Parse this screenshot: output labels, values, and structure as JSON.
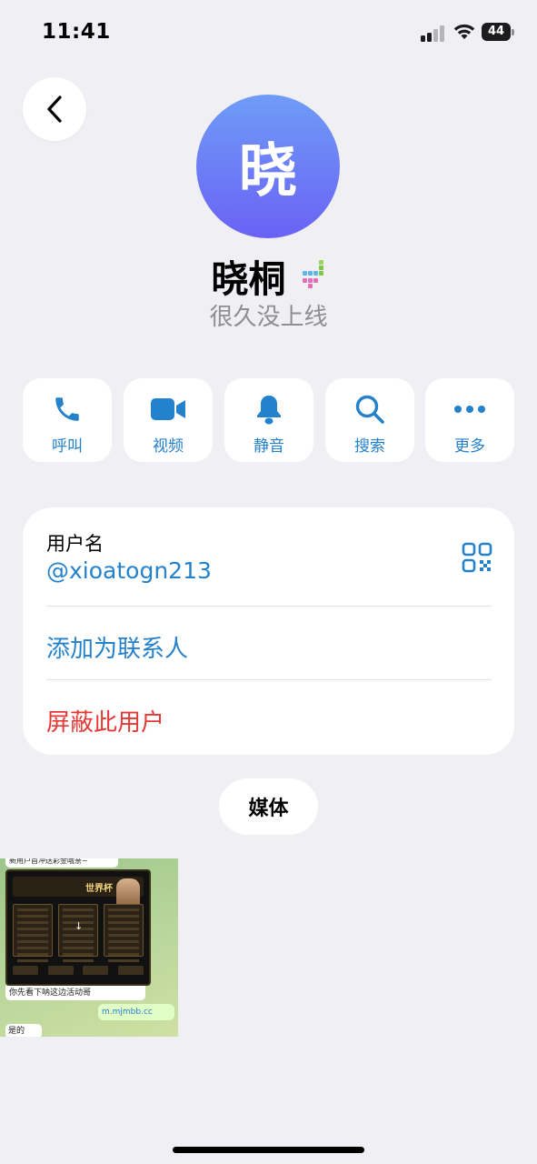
{
  "status_bar": {
    "time": "11:41",
    "battery": "44"
  },
  "profile": {
    "avatar_letter": "晓",
    "name": "晓桐",
    "status": "很久没上线"
  },
  "actions": [
    {
      "label": "呼叫",
      "icon": "phone-icon"
    },
    {
      "label": "视频",
      "icon": "video-icon"
    },
    {
      "label": "静音",
      "icon": "bell-icon"
    },
    {
      "label": "搜索",
      "icon": "search-icon"
    },
    {
      "label": "更多",
      "icon": "more-icon"
    }
  ],
  "info": {
    "username_label": "用户名",
    "username_value": "@xioatogn213",
    "add_contact": "添加为联系人",
    "block_user": "屏蔽此用户"
  },
  "media": {
    "tab_label": "媒体",
    "thumb": {
      "top_text": "新用户首冲送彩金哦亲~",
      "poster_title": "世界杯",
      "caption": "你先看下呐这边活动哥",
      "link": "m.mjmbb.cc",
      "reply": "是的"
    }
  },
  "colors": {
    "accent": "#2481cc",
    "danger": "#e53935",
    "background": "#efeff4",
    "avatar_top": "#6f9cf7",
    "avatar_bottom": "#6a62f5"
  }
}
